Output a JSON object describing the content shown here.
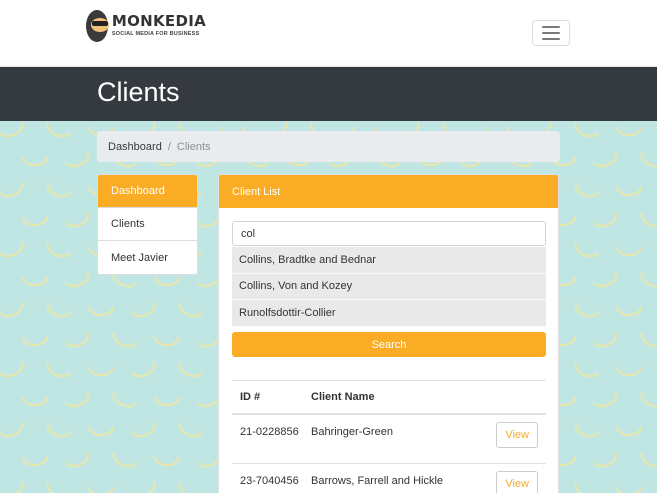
{
  "brand": {
    "title": "MONKEDIA",
    "subtitle": "SOCIAL MEDIA FOR BUSINESS"
  },
  "page": {
    "title": "Clients"
  },
  "breadcrumb": {
    "items": [
      "Dashboard",
      "Clients"
    ]
  },
  "sidebar": {
    "items": [
      {
        "label": "Dashboard",
        "active": true
      },
      {
        "label": "Clients",
        "active": false
      },
      {
        "label": "Meet Javier",
        "active": false
      }
    ]
  },
  "client_list": {
    "header": "Client List",
    "search_value": "col",
    "suggestions": [
      "Collins, Bradtke and Bednar",
      "Collins, Von and Kozey",
      "Runolfsdottir-Collier"
    ],
    "search_button": "Search",
    "columns": [
      "ID #",
      "Client Name",
      ""
    ],
    "rows": [
      {
        "id": "21-0228856",
        "name": "Bahringer-Green",
        "action": "View"
      },
      {
        "id": "23-7040456",
        "name": "Barrows, Farrell and Hickle",
        "action": "View"
      }
    ]
  },
  "colors": {
    "accent": "#f9ac24",
    "header_band": "#343a40",
    "background": "#bfe6e3"
  }
}
